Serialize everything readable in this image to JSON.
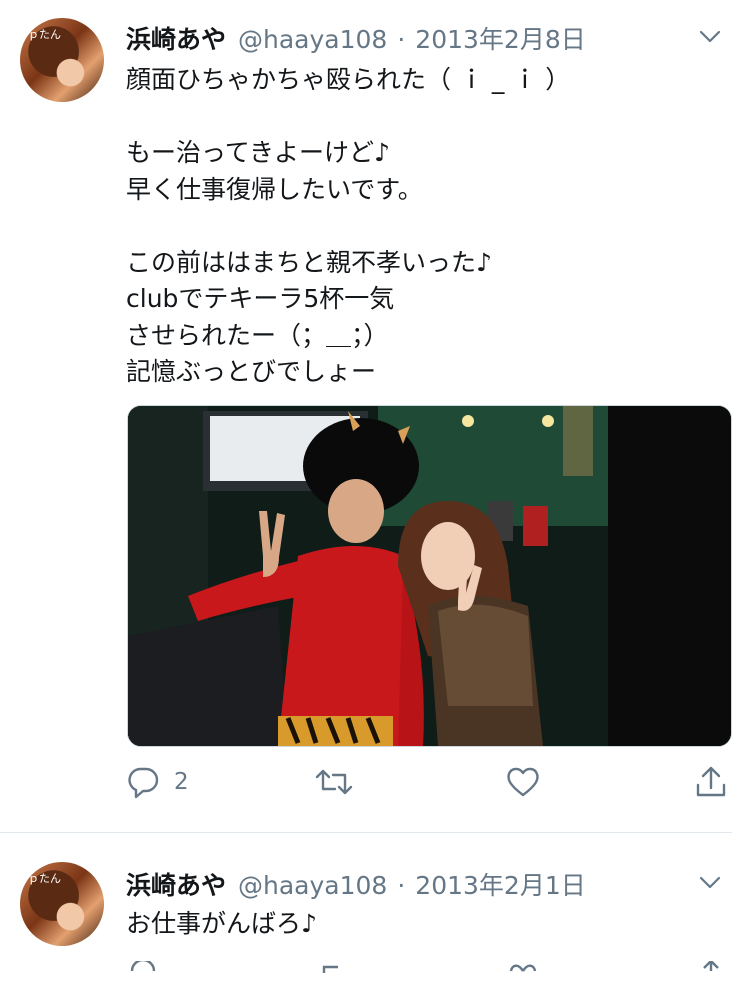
{
  "tweets": [
    {
      "name": "浜崎あや",
      "handle": "@haaya108",
      "separator": "·",
      "date": "2013年2月8日",
      "text": "顔面ひちゃかちゃ殴られた（ ｉ _ ｉ ）\n\nもー治ってきよーけど♪\n早く仕事復帰したいです。\n\nこの前ははまちと親不孝いった♪\nclubでテキーラ5杯一気\nさせられたー（；＿；）\n記憶ぶっとびでしょー",
      "media": {
        "icon": "photo-image",
        "description_hidden": true
      },
      "actions": {
        "reply_count": "2",
        "retweet_count": "",
        "like_count": ""
      }
    },
    {
      "name": "浜崎あや",
      "handle": "@haaya108",
      "separator": "·",
      "date": "2013年2月1日",
      "text": "お仕事がんばろ♪"
    }
  ],
  "avatar_text": "ｐたん",
  "colors": {
    "secondary": "#657786",
    "divider": "#e1e8ed",
    "text": "#14171a"
  },
  "icons": [
    "reply-icon",
    "retweet-icon",
    "like-icon",
    "share-icon",
    "chevron-down-icon"
  ]
}
